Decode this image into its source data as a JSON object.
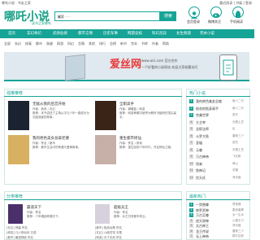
{
  "header": {
    "welcome": "哪吒小说 · 书友之家",
    "top_links": "最近阅读 | 书架 | 登录",
    "logo": "哪吒小说",
    "slogan": "读书之家哪吒",
    "search_placeholder": "搜索 · · ·",
    "search_button": "搜索",
    "icons": [
      {
        "icon": "user-icon",
        "label": "会员登录"
      },
      {
        "icon": "weibo-icon",
        "label": "微博关注"
      },
      {
        "icon": "android-icon",
        "label": "手机阅读"
      }
    ]
  },
  "nav": {
    "items": [
      "首页",
      "玄幻奇幻",
      "武侠仙侠",
      "都市言情",
      "历史军事",
      "网游竞技",
      "科幻灵异",
      "女生频道",
      "完本小说"
    ]
  },
  "subnav": {
    "items": [
      "全部",
      "玄幻",
      "修真",
      "都市",
      "穿越",
      "网游",
      "科幻",
      "言情",
      "其他",
      "排行",
      "总榜",
      "新书",
      "完本",
      "书库",
      "作者",
      "帮助"
    ]
  },
  "banner": {
    "title": "爱丝网",
    "site": "www.aisi.com 官方合作",
    "line": "一个好看的小说网站 欢迎大家收藏访问"
  },
  "hot": {
    "title": "强推推荐",
    "books": [
      {
        "title": "无敌从我的后宫开始",
        "meta": "作者：秋风 / 玄幻 \n 推荐：本书讲述了主角从平凡少年一路成长为无敌强者的故事。",
        "cover": "#1b2230"
      },
      {
        "title": "全职高手",
        "meta": "作者：蝴蝶蓝 / 网游 \n 推荐：网游荣耀中被誉为教科书级别的顶尖高手。",
        "cover": "#3a2418"
      },
      {
        "title": "我的绝色美女总裁老婆",
        "meta": "作者：佚名 / 都市 \n 推荐：都市生活中的奇遇与爱情故事。",
        "cover": "#d8b062"
      },
      {
        "title": "重生都市修仙",
        "meta": "作者：佚名 / 修真 \n 推荐：重生回到少年时代，开启修仙之路。",
        "cover": "#c7b0a8"
      }
    ]
  },
  "category": {
    "title": "分类推荐",
    "books": [
      {
        "title": "霸道天下",
        "meta": "作者：佚名 \n 推荐：少年崛起称霸天下。",
        "cover": "#4a2f6b"
      },
      {
        "title": "超级兵王",
        "meta": "作者：佚名 \n 推荐：兵王归来都市风云。",
        "cover": "#d7d0dd"
      }
    ],
    "list_left": [
      "[玄幻] 神墓  佚名",
      "[修真] 凡人修仙传  忘语",
      "[都市] 最强神医  佚名",
      "[玄幻] 武动乾坤  天蚕",
      "[修真] 遮天  辰东"
    ],
    "list_right": [
      "[都市] 极品仙尊  佚名",
      "[玄幻] 斗破苍穹  天蚕",
      "[网游] 天下无双  佚名",
      "[历史] 赘婿  愤怒香蕉",
      "[都市] 校花贴身  佚名"
    ]
  },
  "ranking": {
    "title": "热门小说",
    "items": [
      "我的绝色美女总裁",
      "校花的贴身高手",
      "完美世界",
      "大主宰",
      "全职法师",
      "斗罗大陆",
      "圣墟",
      "元尊",
      "万古神帝",
      "剑来",
      "牧神记",
      "伏天氏"
    ],
    "authors": [
      "鱼人二代",
      "鱼人二代",
      "辰东",
      "天蚕土豆",
      "乱",
      "唐家三少",
      "辰东",
      "天蚕土豆",
      "飞天鱼",
      "烽火",
      "宅猪",
      "净无痕"
    ]
  },
  "ranking2": {
    "title": "最新热门",
    "items": [
      "一剑独尊",
      "修罗武神",
      "万古至尊",
      "逆天邪神",
      "太古神王",
      "龙王传说",
      "无上神帝"
    ],
    "authors": [
      "青鸾峰",
      "善良蜜蜂",
      "太一生水",
      "火星引力",
      "净无痕",
      "唐家三少",
      "蜗牛狂奔"
    ]
  }
}
